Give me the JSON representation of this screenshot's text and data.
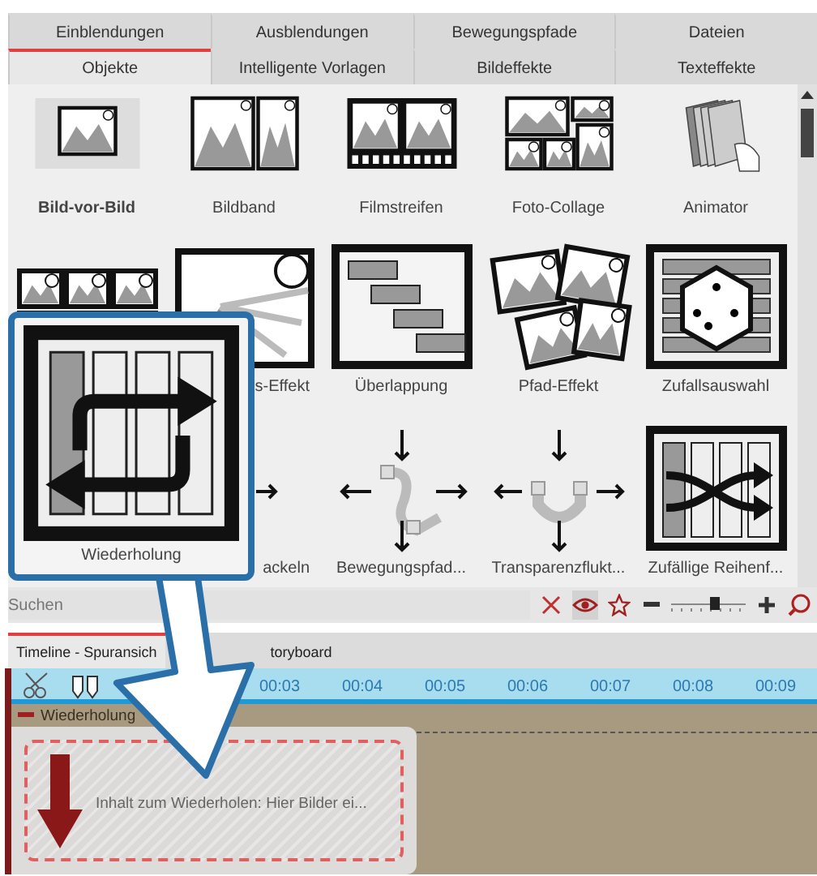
{
  "tabs_row_1": [
    {
      "label": "Einblendungen",
      "selected": false
    },
    {
      "label": "Ausblendungen",
      "selected": false
    },
    {
      "label": "Bewegungspfade",
      "selected": false
    },
    {
      "label": "Dateien",
      "selected": false
    }
  ],
  "tabs_row_2": [
    {
      "label": "Objekte",
      "selected": true
    },
    {
      "label": "Intelligente Vorlagen",
      "selected": false
    },
    {
      "label": "Bildeffekte",
      "selected": false
    },
    {
      "label": "Texteffekte",
      "selected": false
    }
  ],
  "gallery": [
    [
      {
        "kind": "picture-in-picture",
        "label": "Bild-vor-Bild",
        "selected": true
      },
      {
        "kind": "band",
        "label": "Bildband",
        "selected": false
      },
      {
        "kind": "filmstrip",
        "label": "Filmstreifen",
        "selected": false
      },
      {
        "kind": "collage",
        "label": "Foto-Collage",
        "selected": false
      },
      {
        "kind": "flipbook",
        "label": "Animator",
        "selected": false
      }
    ],
    [
      {
        "kind": "grid"
      },
      {
        "kind": "zoom",
        "label": "s-Effekt",
        "selected": false
      },
      {
        "kind": "overlap",
        "label": "Überlappung",
        "selected": false
      },
      {
        "kind": "scatter",
        "label": "Pfad-Effekt",
        "selected": false
      },
      {
        "kind": "dice",
        "label": "Zufallsauswahl",
        "selected": false
      }
    ],
    [
      {
        "kind": "camera",
        "label": "ackeln",
        "selected": false
      },
      {
        "kind": "motion",
        "label": "Bewegungspfad...",
        "selected": false
      },
      {
        "kind": "pipe",
        "label": "Transparenzflukt...",
        "selected": false
      },
      {
        "kind": "shuffle",
        "label": "Zufällige Reihenf...",
        "selected": false
      }
    ]
  ],
  "callout": {
    "kind": "repeat",
    "label": "Wiederholung"
  },
  "search": {
    "placeholder": "Suchen"
  },
  "zoom": {
    "level": 0.58
  },
  "timeline": {
    "tabs": [
      {
        "label": "Timeline - Spuransich",
        "selected": true
      },
      {
        "label": "toryboard",
        "selected": false
      }
    ],
    "ruler": [
      "00:03",
      "00:04",
      "00:05",
      "00:06",
      "00:07",
      "00:08",
      "00:09"
    ],
    "track": {
      "title": "Wiederholung",
      "content": "Inhalt zum Wiederholen: Hier Bilder ei..."
    }
  }
}
